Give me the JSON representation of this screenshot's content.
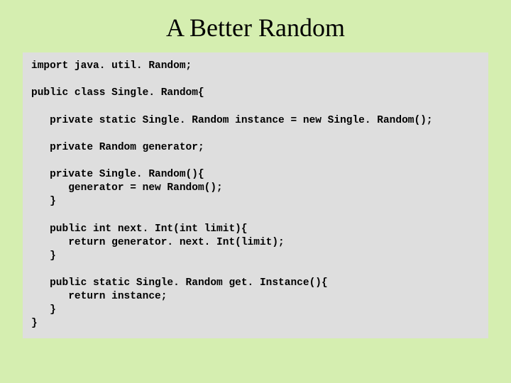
{
  "slide": {
    "title": "A Better Random",
    "code": "import java. util. Random;\n\npublic class Single. Random{\n\n   private static Single. Random instance = new Single. Random();\n\n   private Random generator;\n\n   private Single. Random(){\n      generator = new Random();\n   }\n\n   public int next. Int(int limit){\n      return generator. next. Int(limit);\n   }\n\n   public static Single. Random get. Instance(){\n      return instance;\n   }\n}"
  }
}
